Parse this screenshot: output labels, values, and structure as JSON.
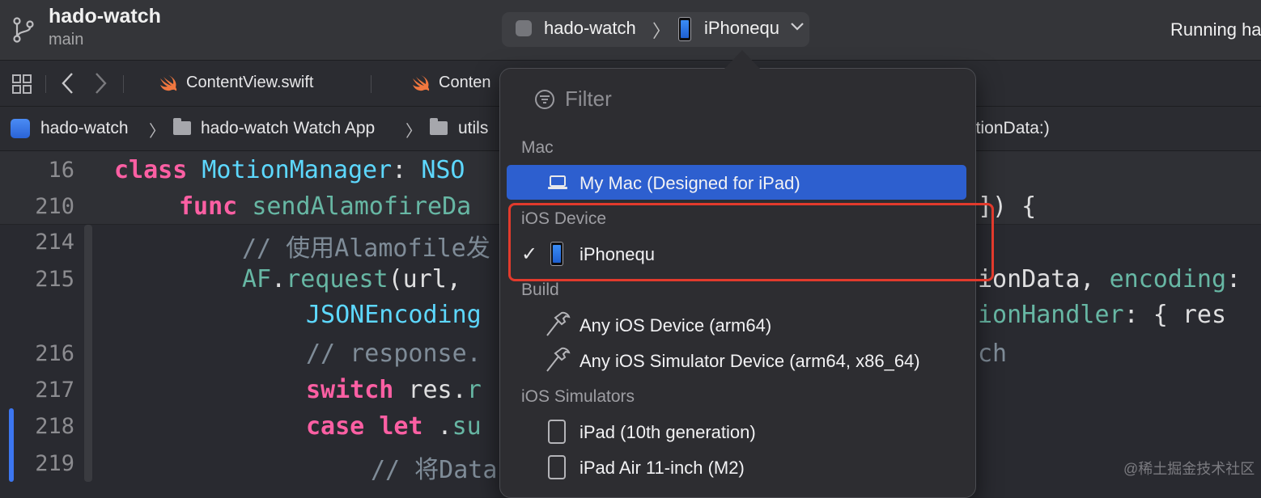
{
  "title_bar": {
    "project_name": "hado-watch",
    "branch": "main",
    "scheme_name": "hado-watch",
    "scheme_separator": "〉",
    "destination_name": "iPhonequ",
    "status_text": "Running ha"
  },
  "tabs": [
    {
      "label": "ContentView.swift"
    },
    {
      "label": "Conten"
    }
  ],
  "breadcrumb": {
    "items": [
      "hado-watch",
      "hado-watch Watch App",
      "utils"
    ],
    "separator": "〉",
    "trailing_text": "otionData:)"
  },
  "code_lines": [
    {
      "line": "16",
      "parts": [
        [
          "kw",
          "class"
        ],
        [
          "pl",
          " "
        ],
        [
          "ty",
          "MotionManager"
        ],
        [
          "pl",
          ": "
        ],
        [
          "ty",
          "NSO"
        ]
      ]
    },
    {
      "line": "210",
      "parts": [
        [
          "kw",
          "func"
        ],
        [
          "pl",
          " "
        ],
        [
          "fn",
          "sendAlamofireDa"
        ]
      ],
      "right": [
        [
          "pl",
          "]) {"
        ]
      ]
    },
    {
      "line": "214",
      "parts": [
        [
          "cm",
          "// 使用Alamofile发"
        ]
      ]
    },
    {
      "line": "215",
      "parts": [
        [
          "fn",
          "AF"
        ],
        [
          "pl",
          "."
        ],
        [
          "fn",
          "request"
        ],
        [
          "pl",
          "(url,"
        ]
      ],
      "right": [
        [
          "pl",
          "ionData, "
        ],
        [
          "fn",
          "encoding"
        ],
        [
          "pl",
          ":"
        ]
      ]
    },
    {
      "line": "",
      "parts": [
        [
          "ty",
          "JSONEncoding"
        ]
      ],
      "right": [
        [
          "fn",
          "ionHandler"
        ],
        [
          "pl",
          ": { res"
        ]
      ]
    },
    {
      "line": "216",
      "parts": [
        [
          "cm",
          "// response."
        ]
      ],
      "right": [
        [
          "cm",
          "ch"
        ]
      ]
    },
    {
      "line": "217",
      "parts": [
        [
          "kw",
          "switch"
        ],
        [
          "pl",
          " res."
        ],
        [
          "fn",
          "r"
        ]
      ]
    },
    {
      "line": "218",
      "parts": [
        [
          "kw",
          "case"
        ],
        [
          "pl",
          " "
        ],
        [
          "kw",
          "let"
        ],
        [
          "pl",
          " ."
        ],
        [
          "fn",
          "su"
        ]
      ]
    },
    {
      "line": "219",
      "parts": [
        [
          "cm",
          "// 将Data"
        ]
      ]
    }
  ],
  "popover": {
    "filter_placeholder": "Filter",
    "sections": {
      "mac": "Mac",
      "ios_device": "iOS Device",
      "build": "Build",
      "ios_simulators": "iOS Simulators"
    },
    "items": {
      "my_mac": "My Mac (Designed for iPad)",
      "iphonequ": "iPhonequ",
      "checkmark": "✓",
      "any_ios_device": "Any iOS Device (arm64)",
      "any_ios_simulator": "Any iOS Simulator Device (arm64, x86_64)",
      "ipad_10th": "iPad (10th generation)",
      "ipad_air": "iPad Air 11-inch (M2)"
    }
  },
  "watermark": "@稀土掘金技术社区",
  "colors": {
    "selection": "#2d5fcf",
    "highlight_box": "#e23a2c",
    "keyword": "#fc5fa3",
    "type": "#5dd8ff",
    "function": "#67b7a4",
    "comment": "#7f8c98"
  }
}
